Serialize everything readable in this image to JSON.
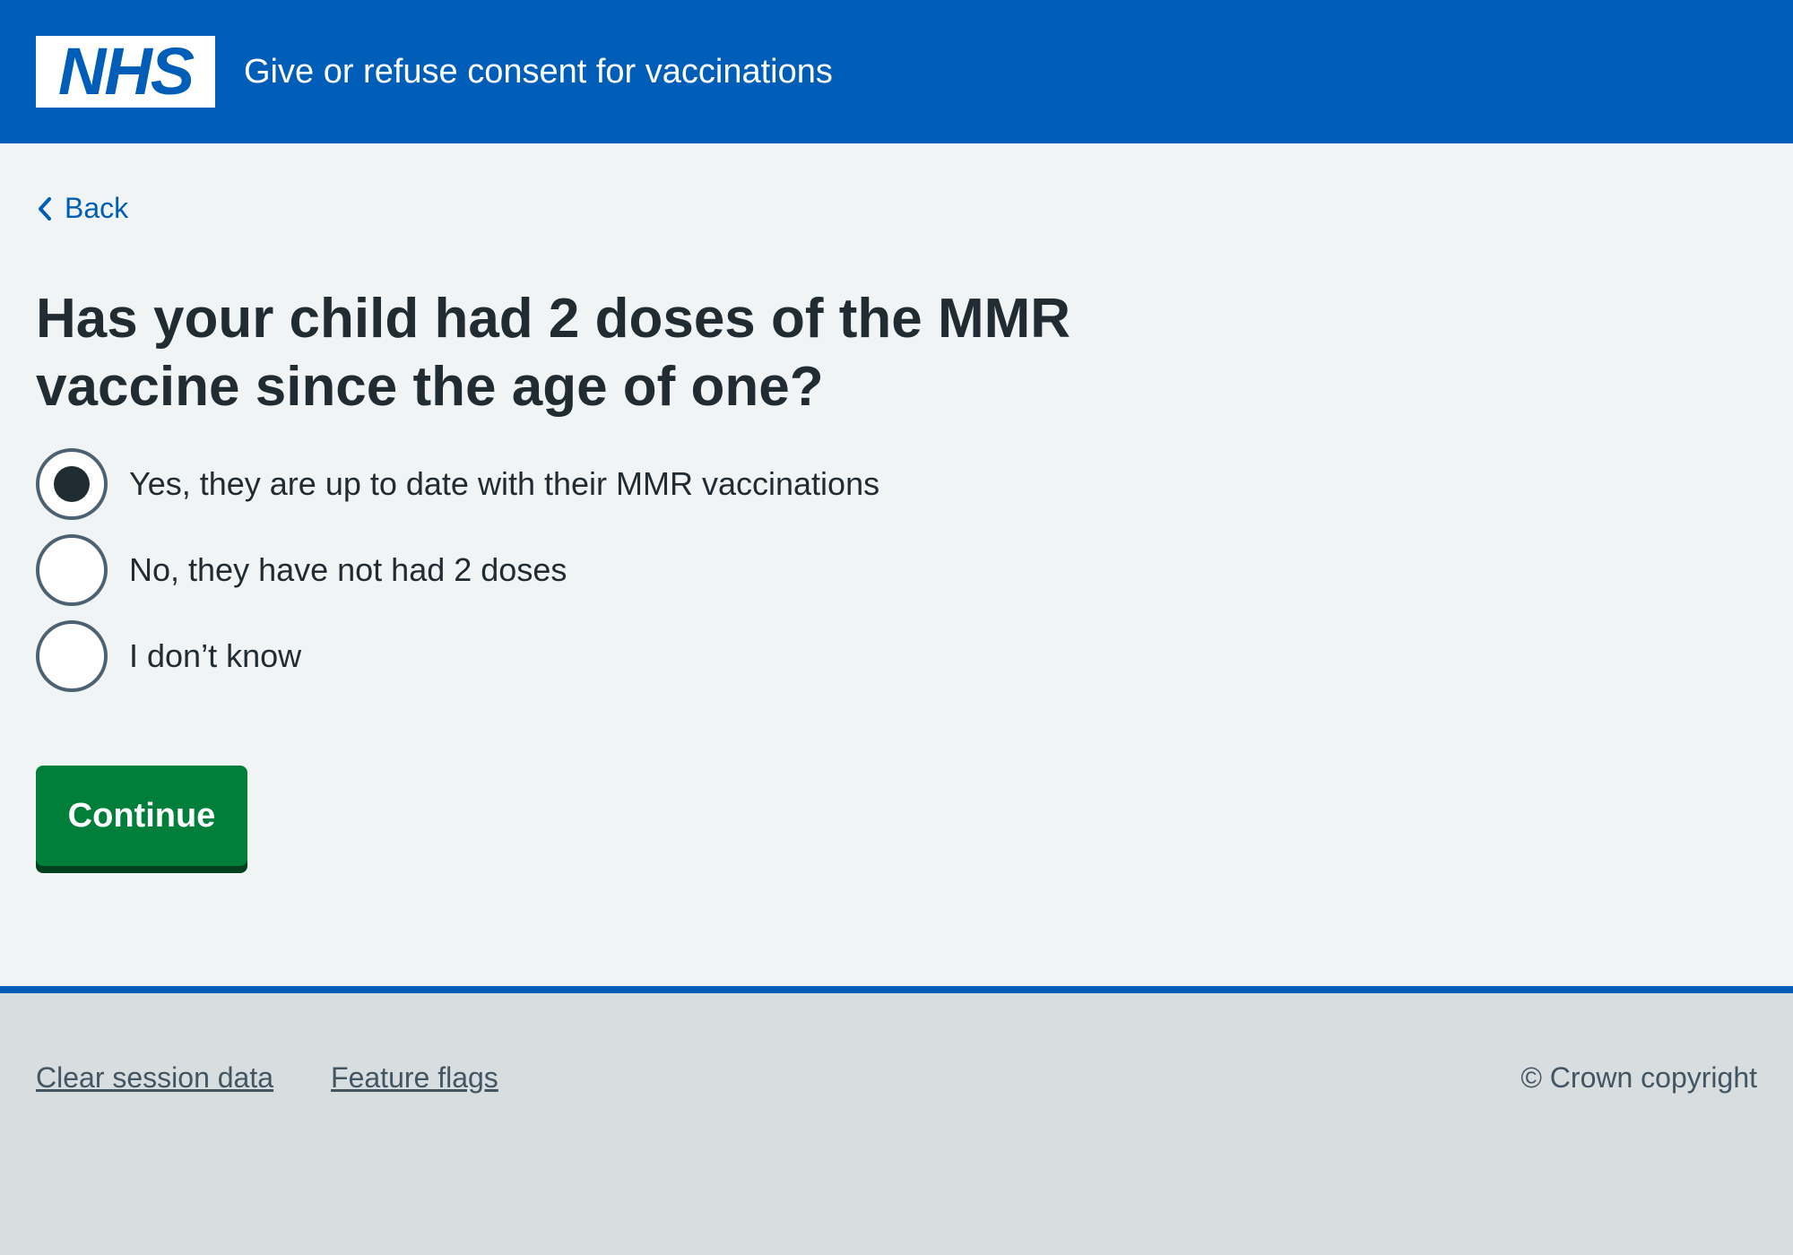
{
  "header": {
    "logo_text": "NHS",
    "service_name": "Give or refuse consent for vaccinations"
  },
  "nav": {
    "back_label": "Back"
  },
  "question": {
    "heading": "Has your child had 2 doses of the MMR vaccine since the age of one?",
    "options": [
      {
        "label": "Yes, they are up to date with their MMR vaccinations",
        "selected": true
      },
      {
        "label": "No, they have not had 2 doses",
        "selected": false
      },
      {
        "label": "I don’t know",
        "selected": false
      }
    ]
  },
  "actions": {
    "continue_label": "Continue"
  },
  "footer": {
    "links": [
      "Clear session data",
      "Feature flags"
    ],
    "copyright": "© Crown copyright"
  },
  "colors": {
    "header_blue": "#005eb8",
    "page_background": "#f0f4f5",
    "button_green": "#007f3b",
    "footer_background": "#d8dde0",
    "text_dark": "#212b32"
  },
  "icons": {
    "back": "chevron-left-icon"
  }
}
